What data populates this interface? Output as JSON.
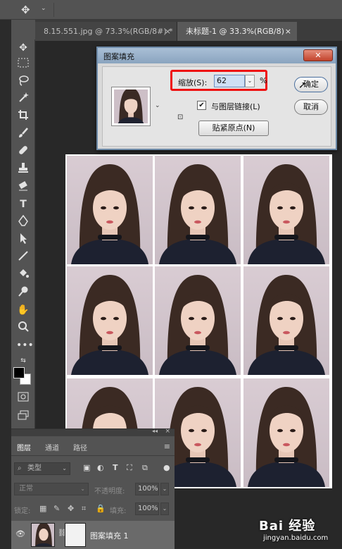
{
  "options_bar": {
    "move_icon": "move-icon",
    "caret": "⌄"
  },
  "tabs": [
    {
      "label": "8.15.551.jpg @ 73.3%(RGB/8#) *",
      "close": "×"
    },
    {
      "label": "未标题-1 @ 33.3%(RGB/8)",
      "close": "×"
    }
  ],
  "tools": [
    "move-tool",
    "marquee-tool",
    "lasso-tool",
    "magic-wand-tool",
    "crop-tool",
    "brush-tool",
    "healing-tool",
    "stamp-tool",
    "eraser-tool",
    "type-tool",
    "pen-tool",
    "path-select-tool",
    "line-tool",
    "paint-bucket-tool",
    "dodge-tool",
    "hand-tool",
    "zoom-tool",
    "more-tools"
  ],
  "dialog": {
    "title": "图案填充",
    "close": "✕",
    "scale_label": "缩放(S):",
    "scale_value": "62",
    "scale_unit": "%",
    "link_label": "与图层链接(L)",
    "link_checked": true,
    "snap_button": "贴紧原点(N)",
    "ok_button": "确定",
    "cancel_button": "取消"
  },
  "layers_panel": {
    "tabs": [
      "图层",
      "通道",
      "路径"
    ],
    "active_tab": "图层",
    "filter_kind": "类型",
    "blend_mode": "正常",
    "opacity_label": "不透明度:",
    "opacity_value": "100%",
    "lock_label": "锁定:",
    "fill_label": "填充:",
    "fill_value": "100%",
    "layer_name": "图案填充 1"
  },
  "watermark": {
    "logo": "Bai 经验",
    "url": "jingyan.baidu.com"
  }
}
